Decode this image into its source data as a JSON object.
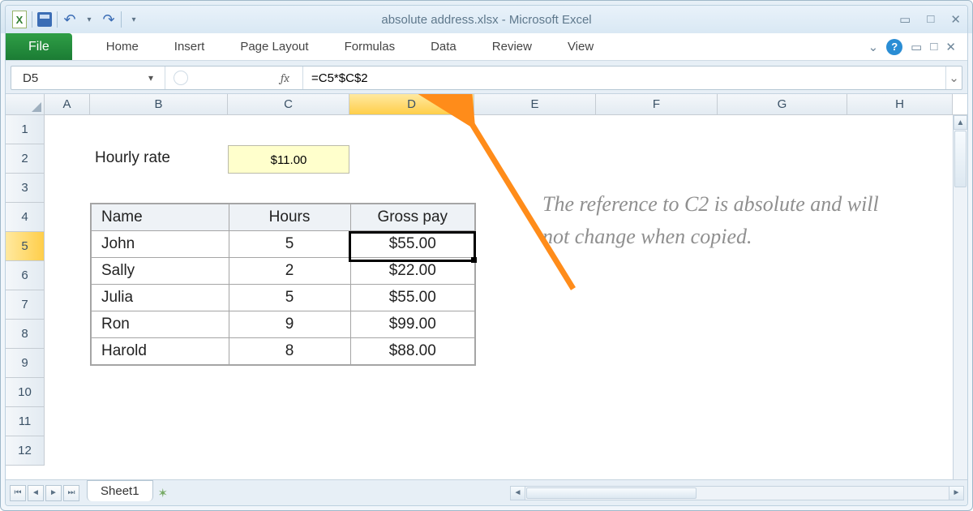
{
  "title": "absolute address.xlsx  -  Microsoft Excel",
  "ribbon": {
    "file": "File",
    "tabs": [
      "Home",
      "Insert",
      "Page Layout",
      "Formulas",
      "Data",
      "Review",
      "View"
    ]
  },
  "namebox": "D5",
  "fx_label": "fx",
  "formula": "=C5*$C$2",
  "columns": [
    "A",
    "B",
    "C",
    "D",
    "E",
    "F",
    "G",
    "H"
  ],
  "selected_col": "D",
  "selected_row": 5,
  "row_count": 12,
  "hourly_rate_label": "Hourly rate",
  "hourly_rate_value": "$11.00",
  "table": {
    "headers": [
      "Name",
      "Hours",
      "Gross pay"
    ],
    "rows": [
      {
        "name": "John",
        "hours": "5",
        "gross": "$55.00"
      },
      {
        "name": "Sally",
        "hours": "2",
        "gross": "$22.00"
      },
      {
        "name": "Julia",
        "hours": "5",
        "gross": "$55.00"
      },
      {
        "name": "Ron",
        "hours": "9",
        "gross": "$99.00"
      },
      {
        "name": "Harold",
        "hours": "8",
        "gross": "$88.00"
      }
    ]
  },
  "annotation": "The reference to C2 is absolute and will not change when copied.",
  "sheet_tab": "Sheet1",
  "icons": {
    "undo": "↶",
    "redo": "↷",
    "dropdown": "▾",
    "min": "▭",
    "max": "□",
    "close": "✕",
    "help": "?",
    "chevron": "⌄",
    "left": "◄",
    "right": "►",
    "first": "⏮",
    "last": "⏭",
    "up": "▲",
    "down": "▼"
  }
}
